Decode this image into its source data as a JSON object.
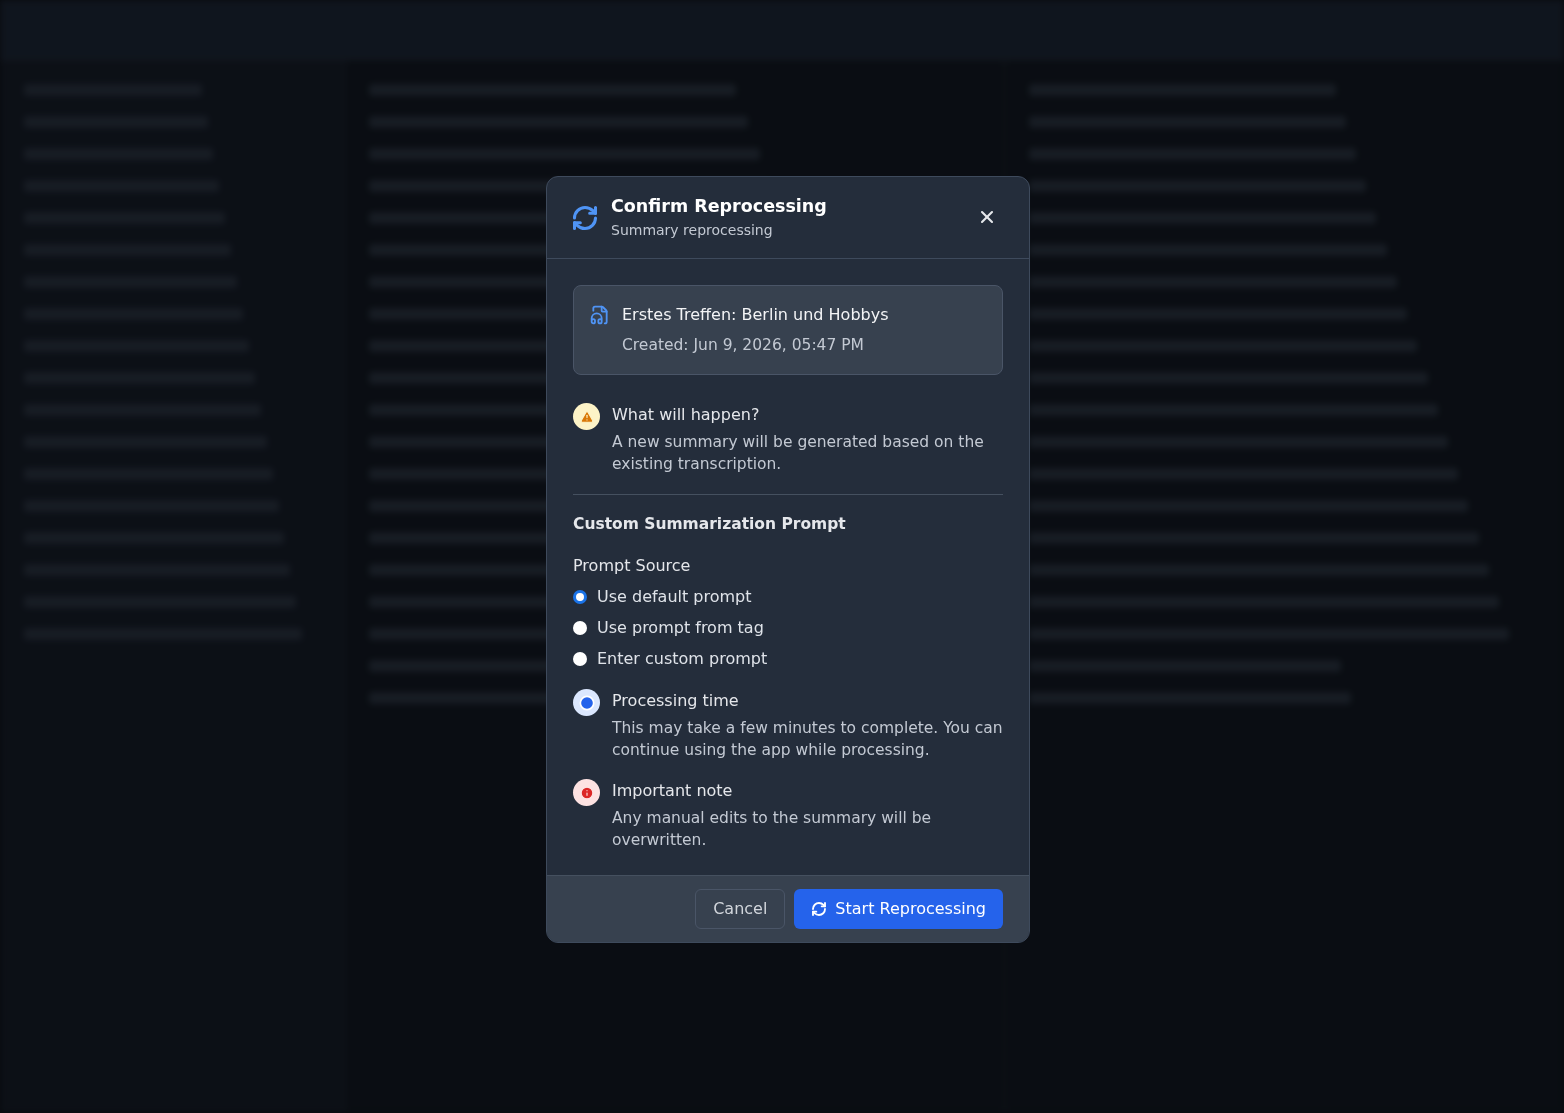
{
  "dialog": {
    "title": "Confirm Reprocessing",
    "subtitle": "Summary reprocessing",
    "recording": {
      "title": "Erstes Treffen: Berlin und Hobbys",
      "created": "Created: Jun 9, 2026, 05:47 PM"
    },
    "notices": [
      {
        "kind": "warning",
        "title": "What will happen?",
        "text": "A new summary will be generated based on the existing transcription."
      }
    ],
    "prompt": {
      "heading": "Custom Summarization Prompt",
      "source_label": "Prompt Source",
      "options": [
        {
          "label": "Use default prompt",
          "selected": true
        },
        {
          "label": "Use prompt from tag",
          "selected": false
        },
        {
          "label": "Enter custom prompt",
          "selected": false
        }
      ]
    },
    "info": [
      {
        "kind": "time",
        "title": "Processing time",
        "text": "This may take a few minutes to complete. You can continue using the app while processing."
      },
      {
        "kind": "error",
        "title": "Important note",
        "text": "Any manual edits to the summary will be overwritten."
      }
    ],
    "cancel": "Cancel",
    "confirm": "Start Reprocessing"
  }
}
